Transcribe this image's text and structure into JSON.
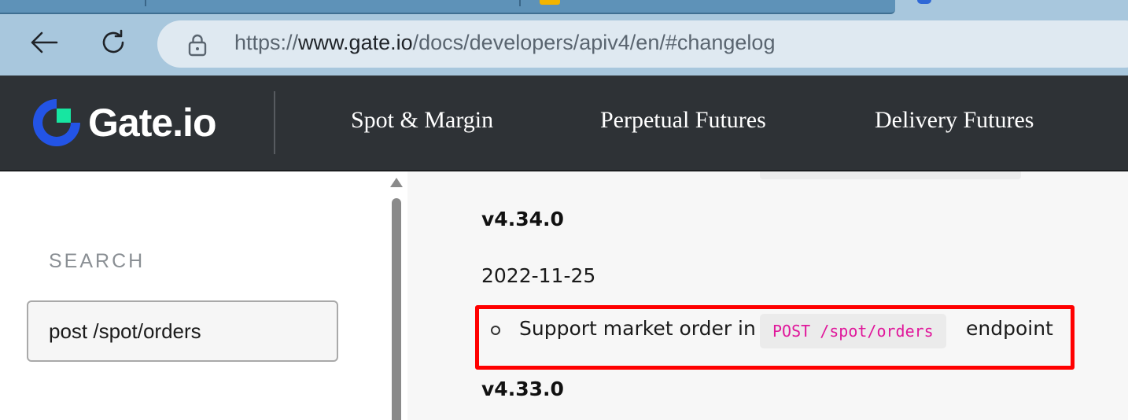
{
  "browser": {
    "url_prefix": "https://",
    "url_host": "www.gate.io",
    "url_path": "/docs/developers/apiv4/en/#changelog",
    "icons": {
      "back": "back-arrow-icon",
      "reload": "reload-icon",
      "lock": "lock-icon"
    }
  },
  "header": {
    "logo_text": "Gate.io",
    "nav": [
      {
        "label": "Spot & Margin"
      },
      {
        "label": "Perpetual Futures"
      },
      {
        "label": "Delivery Futures"
      }
    ],
    "colors": {
      "bg": "#2e3236",
      "logo_blue": "#2354e6",
      "logo_green": "#17e6a1"
    }
  },
  "sidebar": {
    "search_label": "SEARCH",
    "search_value": "post /spot/orders"
  },
  "changelog": {
    "entry1": {
      "version": "v4.34.0",
      "date": "2022-11-25"
    },
    "item": {
      "text_before": "Support market order in",
      "code": "POST /spot/orders",
      "text_after": "endpoint"
    },
    "entry2": {
      "version": "v4.33.0"
    },
    "colors": {
      "code_text": "#e0189b",
      "highlight": "#ff0000"
    }
  }
}
